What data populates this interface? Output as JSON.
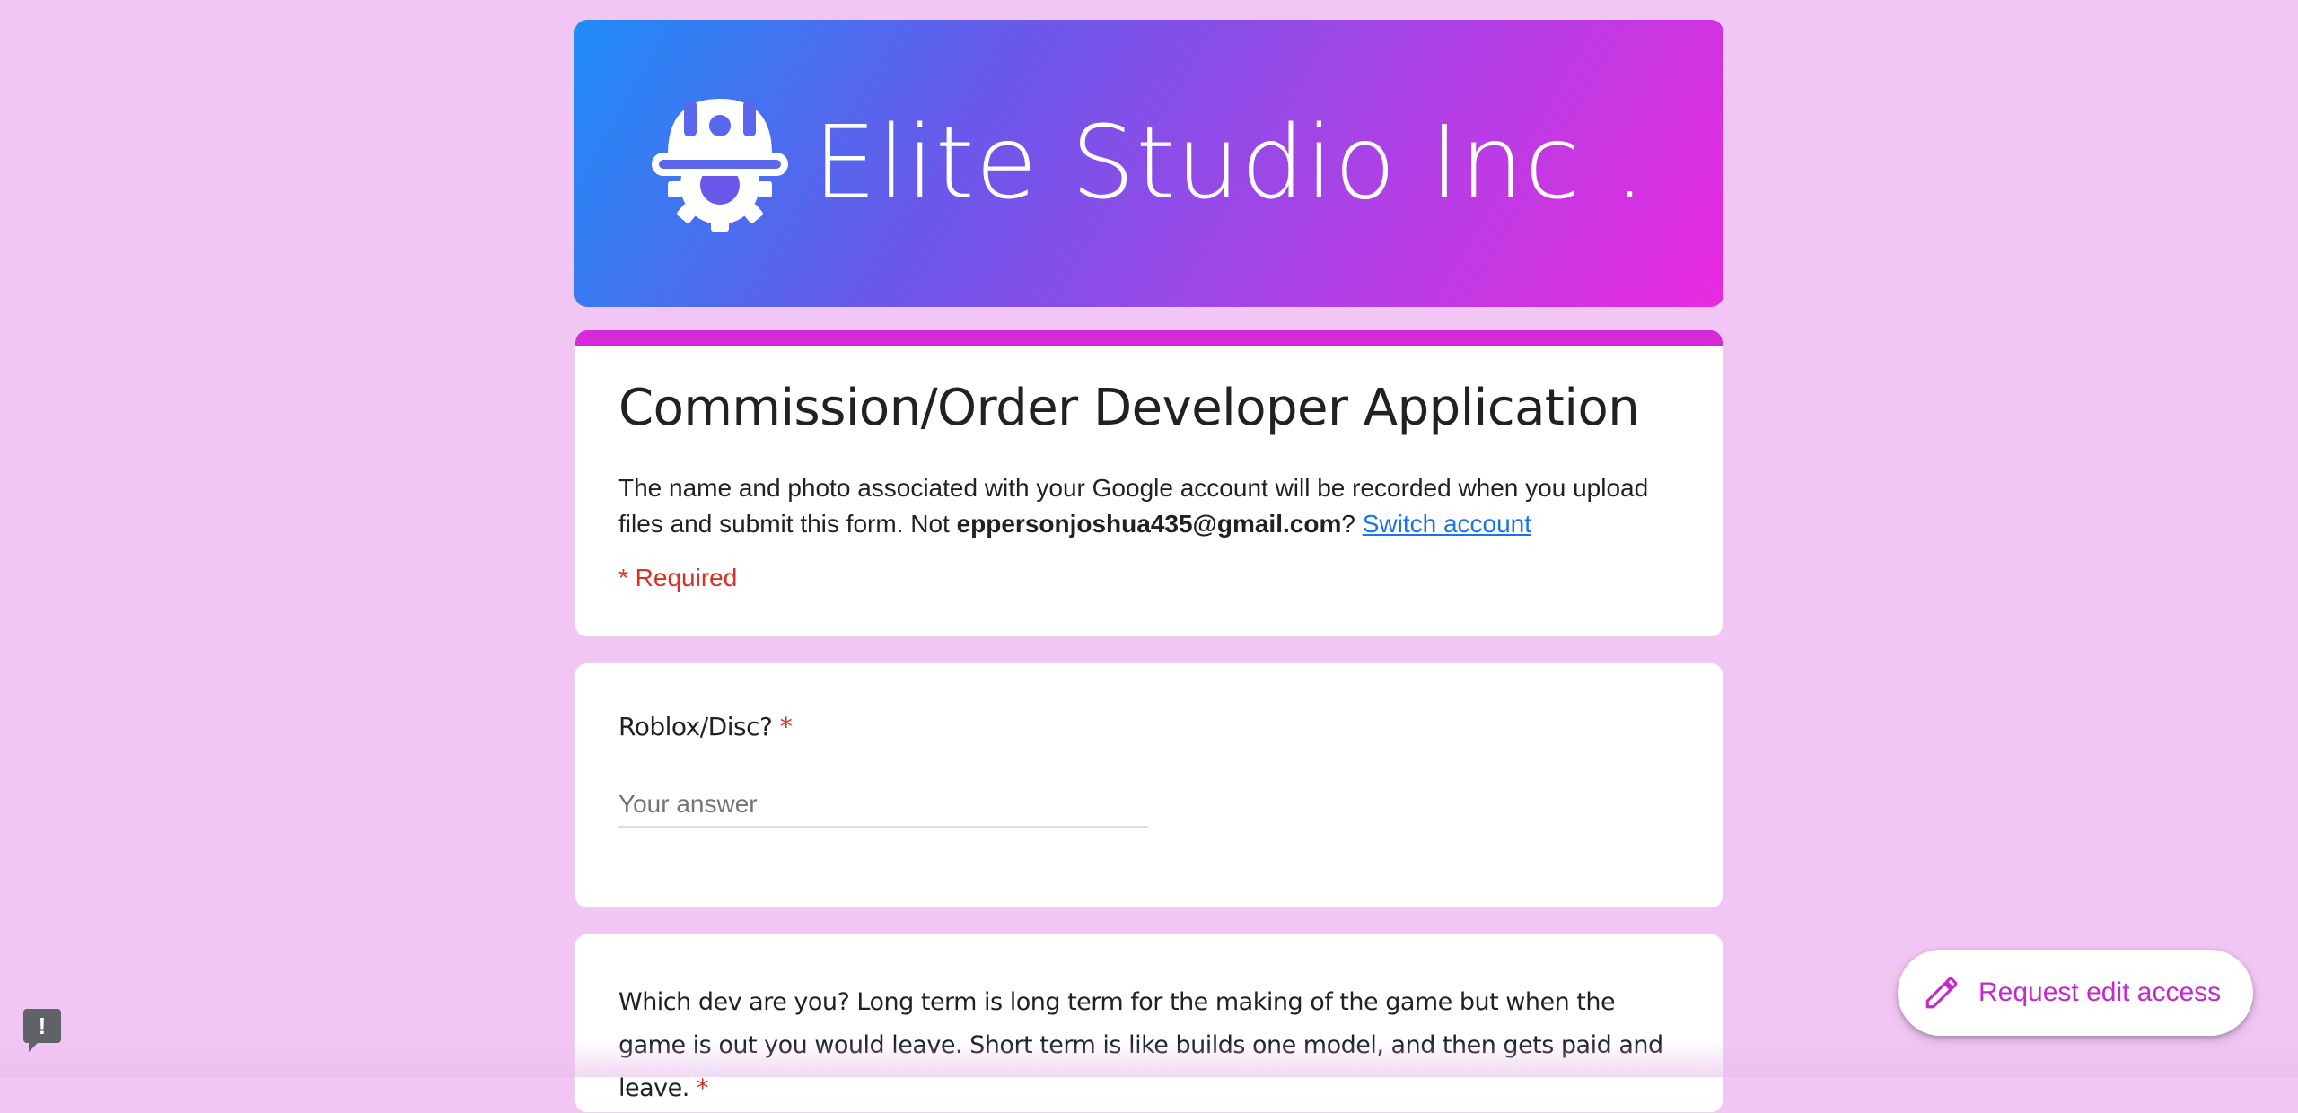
{
  "header": {
    "brand_name": "Elite Studio Inc .",
    "logo_icon": "gear-hardhat-icon"
  },
  "form": {
    "title": "Commission/Order Developer Application",
    "desc_prefix": "The name and photo associated with your Google account will be recorded when you upload files and submit this form. Not ",
    "email": "eppersonjoshua435@gmail.com",
    "desc_q": "?",
    "switch_account": "Switch account",
    "required_note": "* Required"
  },
  "questions": [
    {
      "label": "Roblox/Disc?",
      "required_mark": "*",
      "placeholder": "Your answer"
    },
    {
      "label": "Which dev are you? Long term is long term for the making of the game but when the game is out you would leave. Short term is like builds one model, and then gets paid and leave.",
      "required_mark": "*"
    }
  ],
  "fab": {
    "label": "Request edit access",
    "icon": "pencil-icon"
  },
  "report": {
    "icon": "report-issue-icon",
    "glyph": "!"
  },
  "colors": {
    "background": "#f1c6f5",
    "accent": "#d52ad9",
    "required": "#d93025",
    "link": "#1a73e8"
  }
}
